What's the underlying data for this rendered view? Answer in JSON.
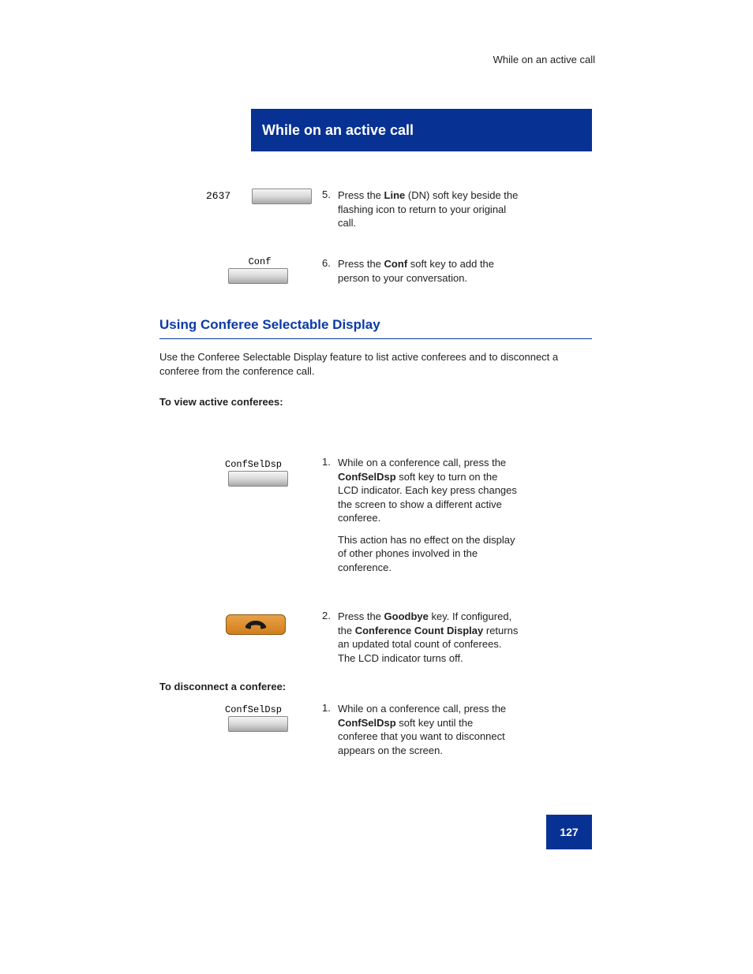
{
  "header": {
    "breadcrumb": "While on an active call"
  },
  "banner": {
    "title": "While on an active call"
  },
  "section1": {
    "step5_num": "5.",
    "step5_text_a": "Press the",
    "step5_text_b": "Line",
    "step5_text_c": "(DN) soft key beside the",
    "step5_text_d": "flashing icon to return to your original",
    "step5_text_e": "call.",
    "label_2637": "2637",
    "step6_num": "6.",
    "step6_text_a": "Press the",
    "step6_text_b": "Conf",
    "step6_text_c": "soft key to add the",
    "step6_text_d": "person to your conversation.",
    "conf_label": "Conf"
  },
  "section2": {
    "heading": "Using Conferee Selectable Display",
    "para": "Use the Conferee Selectable Display feature to list active conferees and to disconnect a conferee from the conference call.",
    "steps_label": "To view active conferees:",
    "step1": {
      "num": "1.",
      "text_a": "While on a conference call, press the",
      "text_b": "ConfSelDsp",
      "text_c": "soft key to turn on the",
      "text_d": "LCD indicator. Each key press changes",
      "text_e": "the screen to show a different active",
      "text_f": "conferee.",
      "note_a": "This action has no effect on the display",
      "note_b": "of other phones involved in the",
      "note_c": "conference."
    },
    "confseldsp_label1": "ConfSelDsp",
    "step2": {
      "num": "2.",
      "text_a": "Press the",
      "text_b": "Goodbye",
      "text_c": "key. If configured,",
      "text_d": "the",
      "text_e": "Conference Count Display",
      "text_f": "returns",
      "text_g": "an updated total count of conferees.",
      "text_h": "The LCD indicator turns off."
    },
    "steps_label2": "To disconnect a conferee:",
    "step3": {
      "num": "1.",
      "text_a": "While on a conference call, press the",
      "text_b": "ConfSelDsp",
      "text_c": "soft key until the",
      "text_d": "conferee that you want to disconnect",
      "text_e": "appears on the screen."
    },
    "confseldsp_label2": "ConfSelDsp"
  },
  "page_number": "127"
}
